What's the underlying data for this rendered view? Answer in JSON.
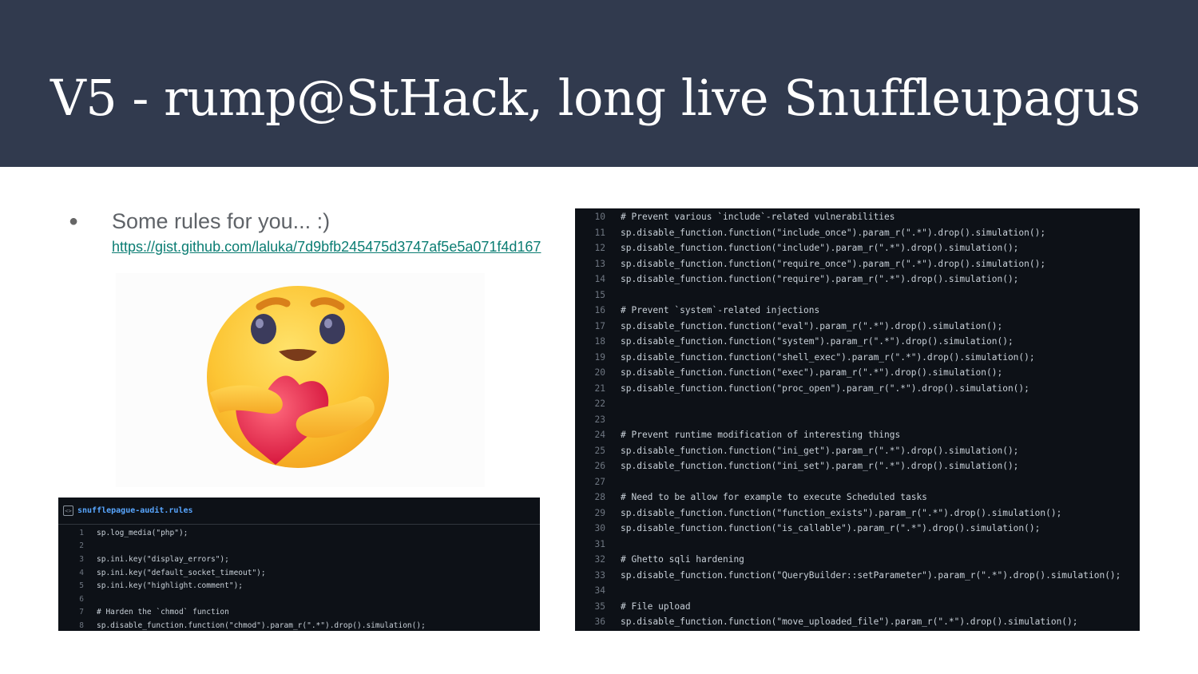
{
  "slide": {
    "title": "V5 - rump@StHack, long live Snuffleupagus",
    "bullet_symbol": "●",
    "bullet_text": "Some rules for you... :)",
    "link_text": "https://gist.github.com/laluka/7d9bfb245475d3747af5e5a071f4d167",
    "emoji_name": "care-emoji"
  },
  "small_code": {
    "filename": "snufflepague-audit.rules",
    "icon": "<>",
    "lines": [
      {
        "num": "1",
        "code": "sp.log_media(\"php\");"
      },
      {
        "num": "2",
        "code": ""
      },
      {
        "num": "3",
        "code": "sp.ini.key(\"display_errors\");"
      },
      {
        "num": "4",
        "code": "sp.ini.key(\"default_socket_timeout\");"
      },
      {
        "num": "5",
        "code": "sp.ini.key(\"highlight.comment\");"
      },
      {
        "num": "6",
        "code": ""
      },
      {
        "num": "7",
        "code": "# Harden the `chmod` function"
      },
      {
        "num": "8",
        "code": "sp.disable_function.function(\"chmod\").param_r(\".*\").drop().simulation();"
      }
    ]
  },
  "big_code": {
    "lines": [
      {
        "num": "10",
        "code": "# Prevent various `include`-related vulnerabilities"
      },
      {
        "num": "11",
        "code": "sp.disable_function.function(\"include_once\").param_r(\".*\").drop().simulation();"
      },
      {
        "num": "12",
        "code": "sp.disable_function.function(\"include\").param_r(\".*\").drop().simulation();"
      },
      {
        "num": "13",
        "code": "sp.disable_function.function(\"require_once\").param_r(\".*\").drop().simulation();"
      },
      {
        "num": "14",
        "code": "sp.disable_function.function(\"require\").param_r(\".*\").drop().simulation();"
      },
      {
        "num": "15",
        "code": ""
      },
      {
        "num": "16",
        "code": "# Prevent `system`-related injections"
      },
      {
        "num": "17",
        "code": "sp.disable_function.function(\"eval\").param_r(\".*\").drop().simulation();"
      },
      {
        "num": "18",
        "code": "sp.disable_function.function(\"system\").param_r(\".*\").drop().simulation();"
      },
      {
        "num": "19",
        "code": "sp.disable_function.function(\"shell_exec\").param_r(\".*\").drop().simulation();"
      },
      {
        "num": "20",
        "code": "sp.disable_function.function(\"exec\").param_r(\".*\").drop().simulation();"
      },
      {
        "num": "21",
        "code": "sp.disable_function.function(\"proc_open\").param_r(\".*\").drop().simulation();"
      },
      {
        "num": "22",
        "code": ""
      },
      {
        "num": "23",
        "code": ""
      },
      {
        "num": "24",
        "code": "# Prevent runtime modification of interesting things"
      },
      {
        "num": "25",
        "code": "sp.disable_function.function(\"ini_get\").param_r(\".*\").drop().simulation();"
      },
      {
        "num": "26",
        "code": "sp.disable_function.function(\"ini_set\").param_r(\".*\").drop().simulation();"
      },
      {
        "num": "27",
        "code": ""
      },
      {
        "num": "28",
        "code": "# Need to be allow for example to execute Scheduled tasks"
      },
      {
        "num": "29",
        "code": "sp.disable_function.function(\"function_exists\").param_r(\".*\").drop().simulation();"
      },
      {
        "num": "30",
        "code": "sp.disable_function.function(\"is_callable\").param_r(\".*\").drop().simulation();"
      },
      {
        "num": "31",
        "code": ""
      },
      {
        "num": "32",
        "code": "# Ghetto sqli hardening"
      },
      {
        "num": "33",
        "code": "sp.disable_function.function(\"QueryBuilder::setParameter\").param_r(\".*\").drop().simulation();"
      },
      {
        "num": "34",
        "code": ""
      },
      {
        "num": "35",
        "code": "# File upload"
      },
      {
        "num": "36",
        "code": "sp.disable_function.function(\"move_uploaded_file\").param_r(\".*\").drop().simulation();"
      }
    ]
  }
}
